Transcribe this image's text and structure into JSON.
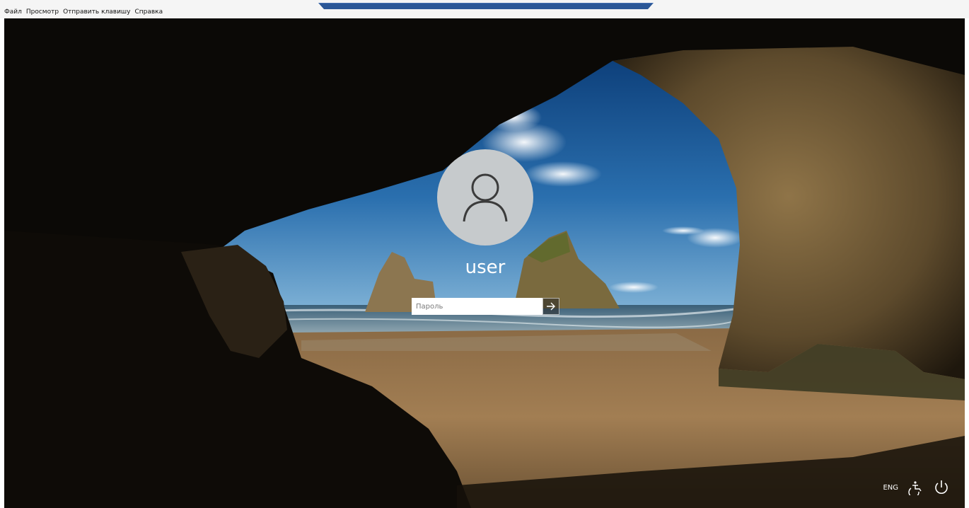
{
  "menubar": {
    "items": [
      "Файл",
      "Просмотр",
      "Отправить клавишу",
      "Справка"
    ]
  },
  "login": {
    "username": "user",
    "password_placeholder": "Пароль",
    "submit_icon": "arrow-right-icon",
    "avatar_icon": "user-icon"
  },
  "tray": {
    "language": "ENG",
    "accessibility_icon": "ease-of-access-icon",
    "power_icon": "power-icon"
  },
  "colors": {
    "menubar_bg": "#f5f5f5",
    "connection_bar": "#2b5797",
    "avatar_bg": "#c6cacc",
    "text_light": "#ffffff"
  }
}
